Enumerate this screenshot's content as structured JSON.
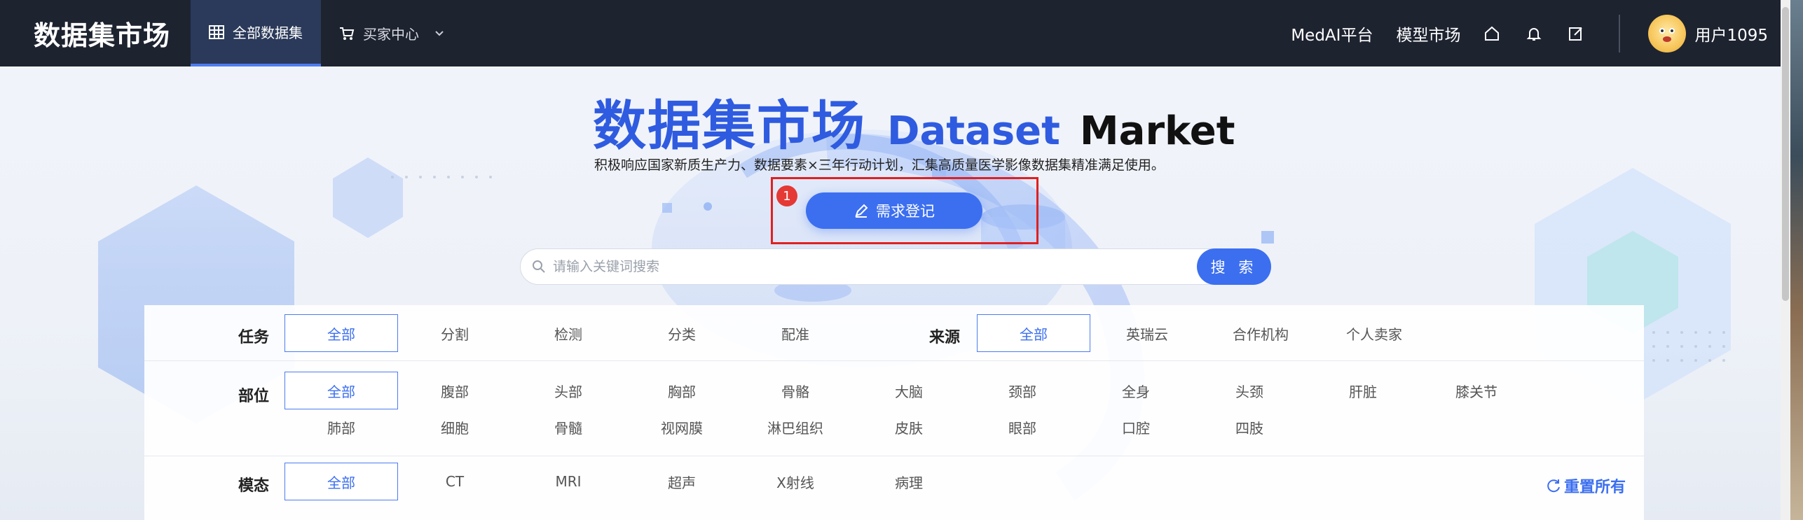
{
  "brand": "数据集市场",
  "nav": {
    "tabs": [
      {
        "label": "全部数据集",
        "icon": "table-icon"
      },
      {
        "label": "买家中心",
        "icon": "cart-icon"
      }
    ],
    "links": [
      "MedAI平台",
      "模型市场"
    ],
    "icons": [
      "home-icon",
      "bell-icon",
      "edit-icon"
    ],
    "username": "用户1095"
  },
  "hero": {
    "title_cn": "数据集市场",
    "title_en1": "Dataset",
    "title_en2": "Market",
    "subtitle": "积极响应国家新质生产力、数据要素×三年行动计划，汇集高质量医学影像数据集精准满足使用。",
    "badge": "1",
    "request_button": "需求登记"
  },
  "search": {
    "placeholder": "请输入关键词搜索",
    "button": "搜 索"
  },
  "filters": {
    "task": {
      "label": "任务",
      "options": [
        "全部",
        "分割",
        "检测",
        "分类",
        "配准"
      ],
      "selected": "全部"
    },
    "source": {
      "label": "来源",
      "options": [
        "全部",
        "英瑞云",
        "合作机构",
        "个人卖家"
      ],
      "selected": "全部"
    },
    "part": {
      "label": "部位",
      "row1": [
        "全部",
        "腹部",
        "头部",
        "胸部",
        "骨骼",
        "大脑",
        "颈部",
        "全身",
        "头颈",
        "肝脏",
        "膝关节"
      ],
      "row2": [
        "肺部",
        "细胞",
        "骨髓",
        "视网膜",
        "淋巴组织",
        "皮肤",
        "眼部",
        "口腔",
        "四肢"
      ],
      "selected": "全部"
    },
    "modality": {
      "label": "模态",
      "options": [
        "全部",
        "CT",
        "MRI",
        "超声",
        "X射线",
        "病理"
      ],
      "selected": "全部"
    },
    "reset": "重置所有"
  }
}
